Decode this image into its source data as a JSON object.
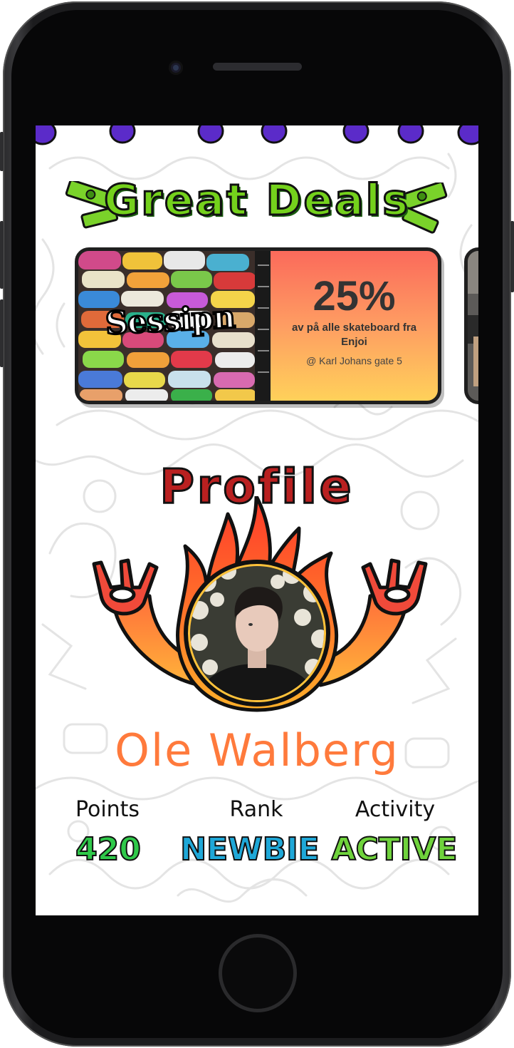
{
  "deals": {
    "title": "Great Deals",
    "cards": [
      {
        "brand": "Sessipn",
        "percent": "25%",
        "description": "av på alle skateboard fra Enjoi",
        "address": "@ Karl Johans gate 5"
      }
    ]
  },
  "profile": {
    "title": "Profile",
    "name": "Ole Walberg",
    "stats": [
      {
        "label": "Points",
        "value": "420",
        "color": "#2fc94a"
      },
      {
        "label": "Rank",
        "value": "NEWBIE",
        "color": "#1fa8d8"
      },
      {
        "label": "Activity",
        "value": "ACTIVE",
        "color": "#6fd33c"
      }
    ]
  },
  "colors": {
    "deals_title": "#74d11c",
    "profile_title": "#b92020",
    "name_gradient_start": "#ff9a3c",
    "name_gradient_end": "#ff3a55",
    "offer_gradient_top": "#fb6a5b",
    "offer_gradient_bottom": "#ffd15a",
    "flame": "#ff6a2a",
    "dots": "#5b2bc9"
  }
}
